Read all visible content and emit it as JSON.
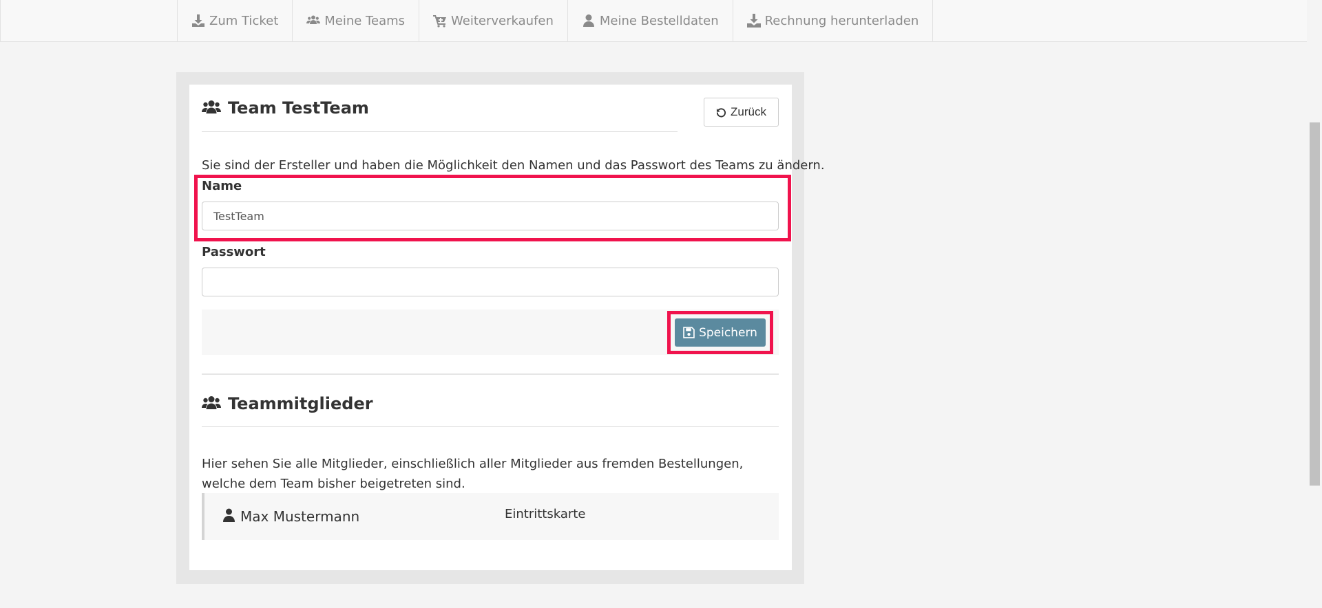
{
  "nav": {
    "items": [
      {
        "label": "Zum Ticket",
        "icon": "download-icon"
      },
      {
        "label": "Meine Teams",
        "icon": "users-icon"
      },
      {
        "label": "Weiterverkaufen",
        "icon": "cart-icon"
      },
      {
        "label": "Meine Bestelldaten",
        "icon": "user-icon"
      },
      {
        "label": "Rechnung herunterladen",
        "icon": "download-tray-icon"
      }
    ]
  },
  "team": {
    "title": "Team TestTeam",
    "back_label": "Zurück",
    "intro": "Sie sind der Ersteller und haben die Möglichkeit den Namen und das Passwort des Teams zu ändern.",
    "name_label": "Name",
    "name_value": "TestTeam",
    "password_label": "Passwort",
    "password_value": "",
    "save_label": "Speichern"
  },
  "members": {
    "title": "Teammitglieder",
    "description": "Hier sehen Sie alle Mitglieder, einschließlich aller Mitglieder aus fremden Bestellungen, welche dem Team bisher beigetreten sind.",
    "rows": [
      {
        "name": "Max Mustermann",
        "ticket_type": "Eintrittskarte"
      }
    ]
  },
  "colors": {
    "highlight": "#f0134d",
    "save_button": "#5b8a9f",
    "page_background": "#f4f4f4"
  }
}
